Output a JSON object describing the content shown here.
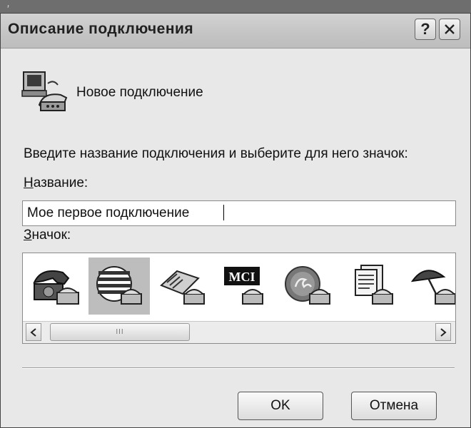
{
  "title": "Описание подключения",
  "title_buttons": {
    "help": "?",
    "close": "✕"
  },
  "connection": {
    "label": "Новое подключение",
    "icon": "dialup-computer-icon"
  },
  "prompt": "Введите название подключения и выберите для него значок:",
  "name_field": {
    "label_first": "Н",
    "label_rest": "азвание:",
    "value": "Мое первое подключение"
  },
  "icon_field": {
    "label_first": "З",
    "label_rest": "начок:"
  },
  "icons": [
    {
      "name": "telephone-icon",
      "selected": false
    },
    {
      "name": "globe-stripes-icon",
      "selected": true
    },
    {
      "name": "fax-icon",
      "selected": false
    },
    {
      "name": "mci-logo-icon",
      "text": "MCI",
      "selected": false
    },
    {
      "name": "ge-logo-icon",
      "selected": false
    },
    {
      "name": "documents-icon",
      "selected": false
    },
    {
      "name": "umbrella-icon",
      "selected": false
    }
  ],
  "scrollbar": {
    "left_arrow": "<",
    "right_arrow": ">",
    "thumb_grip": "III"
  },
  "buttons": {
    "ok": "OK",
    "cancel": "Отмена"
  }
}
